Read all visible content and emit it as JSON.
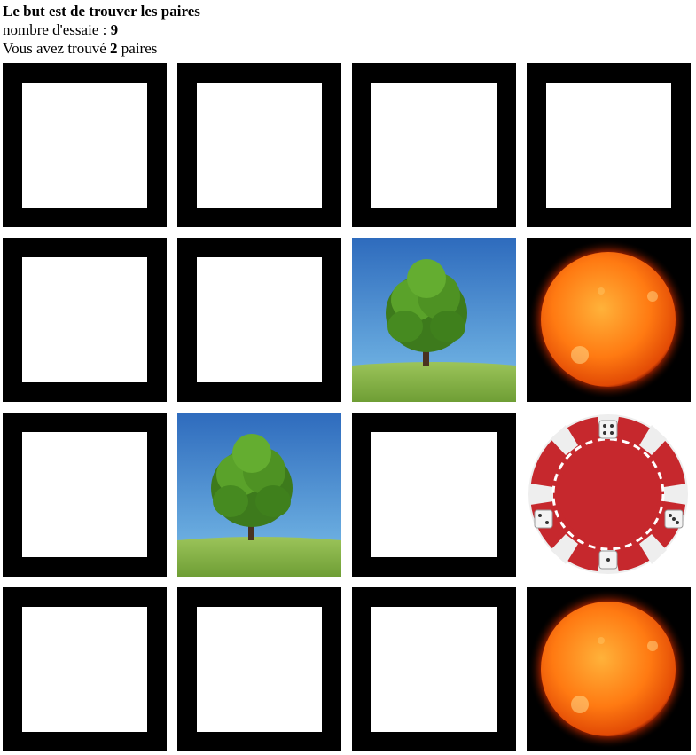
{
  "header": {
    "title": "Le but est de trouver les paires",
    "attempts_label": "nombre d'essaie : ",
    "attempts_value": "9",
    "found_prefix": "Vous avez trouvé ",
    "found_value": "2",
    "found_suffix": " paires"
  },
  "board": {
    "columns": 4,
    "rows": 4,
    "cards": [
      {
        "state": "hidden"
      },
      {
        "state": "hidden"
      },
      {
        "state": "hidden"
      },
      {
        "state": "hidden"
      },
      {
        "state": "hidden"
      },
      {
        "state": "hidden"
      },
      {
        "state": "revealed",
        "image": "tree"
      },
      {
        "state": "revealed",
        "image": "sun"
      },
      {
        "state": "hidden"
      },
      {
        "state": "revealed",
        "image": "tree"
      },
      {
        "state": "hidden"
      },
      {
        "state": "revealed",
        "image": "casino-chip"
      },
      {
        "state": "hidden"
      },
      {
        "state": "hidden"
      },
      {
        "state": "hidden"
      },
      {
        "state": "revealed",
        "image": "sun"
      }
    ]
  }
}
